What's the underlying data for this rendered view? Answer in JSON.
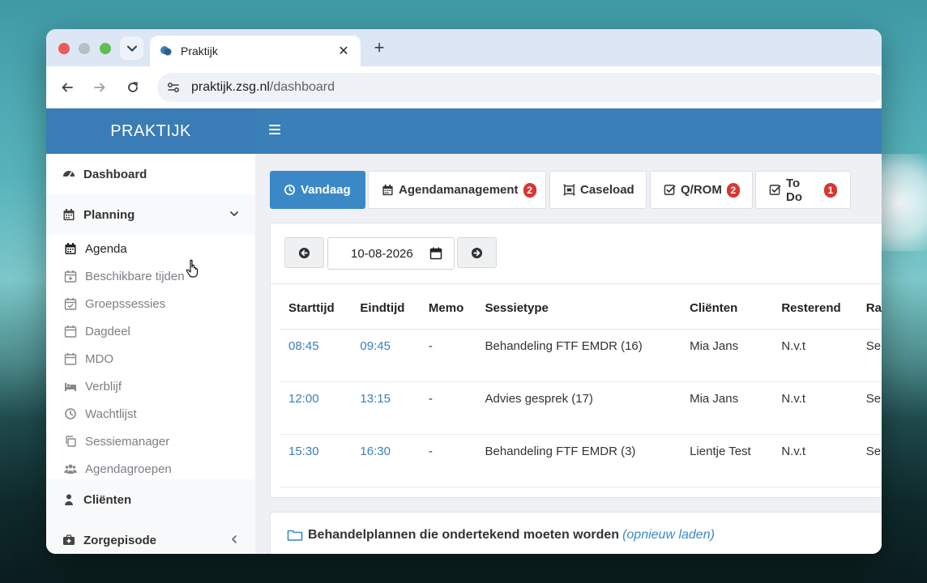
{
  "browser": {
    "tab_title": "Praktijk",
    "tab_close": "✕",
    "new_tab": "+",
    "url_host": "praktijk.zsg.nl",
    "url_path": "/dashboard"
  },
  "app": {
    "brand": "PRAKTIJK"
  },
  "sidebar": {
    "dashboard": "Dashboard",
    "planning": "Planning",
    "planning_items": [
      {
        "label": "Agenda",
        "icon": "calendar-icon"
      },
      {
        "label": "Beschikbare tijden",
        "icon": "calendar-plus-icon"
      },
      {
        "label": "Groepssessies",
        "icon": "calendar-check-icon"
      },
      {
        "label": "Dagdeel",
        "icon": "calendar-icon"
      },
      {
        "label": "MDO",
        "icon": "calendar-icon"
      },
      {
        "label": "Verblijf",
        "icon": "bed-icon"
      },
      {
        "label": "Wachtlijst",
        "icon": "clock-icon"
      },
      {
        "label": "Sessiemanager",
        "icon": "copy-icon"
      },
      {
        "label": "Agendagroepen",
        "icon": "users-icon"
      }
    ],
    "clienten": "Cliënten",
    "zorgepisode": "Zorgepisode"
  },
  "tabs": [
    {
      "label": "Vandaag",
      "badge": ""
    },
    {
      "label": "Agendamanagement",
      "badge": "2"
    },
    {
      "label": "Caseload",
      "badge": ""
    },
    {
      "label": "Q/ROM",
      "badge": "2"
    },
    {
      "label": "To Do",
      "badge": "1"
    }
  ],
  "date": {
    "value": "10-08-2026"
  },
  "table": {
    "headers": [
      "Starttijd",
      "Eindtijd",
      "Memo",
      "Sessietype",
      "Cliënten",
      "Resterend",
      "Ra"
    ],
    "rows": [
      {
        "start": "08:45",
        "end": "09:45",
        "memo": "-",
        "type": "Behandeling FTF EMDR (16)",
        "client": "Mia Jans",
        "remaining": "N.v.t",
        "extra": "Se"
      },
      {
        "start": "12:00",
        "end": "13:15",
        "memo": "-",
        "type": "Advies gesprek (17)",
        "client": "Mia Jans",
        "remaining": "N.v.t",
        "extra": "Se"
      },
      {
        "start": "15:30",
        "end": "16:30",
        "memo": "-",
        "type": "Behandeling FTF EMDR (3)",
        "client": "Lientje Test",
        "remaining": "N.v.t",
        "extra": "Se"
      }
    ]
  },
  "plans": {
    "title": "Behandelplannen die ondertekend moeten worden",
    "reload": "(opnieuw laden)"
  },
  "colors": {
    "header": "#3a7fb8",
    "primary": "#3a89c6",
    "badge": "#d9362f",
    "link": "#3a7fb8"
  }
}
